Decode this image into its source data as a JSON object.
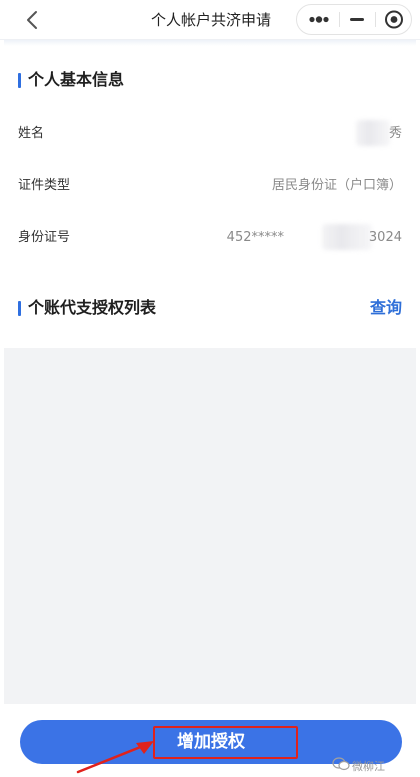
{
  "nav": {
    "title": "个人帐户共济申请",
    "back_icon": "chevron-left-icon",
    "more_icon": "more-dots-icon",
    "minimize_icon": "minimize-icon",
    "close_icon": "target-close-icon"
  },
  "basic_info": {
    "title": "个人基本信息",
    "fields": [
      {
        "label": "姓名",
        "value": "秀"
      },
      {
        "label": "证件类型",
        "value": "居民身份证（户口簿）"
      },
      {
        "label": "身份证号",
        "value_prefix": "452*****",
        "value_suffix": "3024"
      }
    ]
  },
  "auth_list": {
    "title": "个账代支授权列表",
    "query_label": "查询"
  },
  "footer": {
    "add_button_label": "增加授权",
    "watermark": "微柳江"
  },
  "colors": {
    "accent": "#3b73e6",
    "link": "#2f6fd8",
    "section_bar": "#2f6fe0",
    "highlight": "#e0221c",
    "panel_bg": "#f2f3f5"
  }
}
